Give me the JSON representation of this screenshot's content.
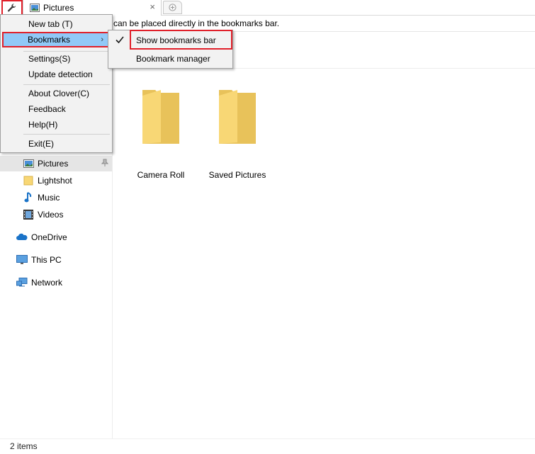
{
  "tabbar": {
    "menu_icon": "wrench-icon",
    "tab": {
      "title": "Pictures",
      "icon": "pictures-folder-icon",
      "close_label": "×"
    },
    "new_tab_icon": "plus-circle-icon"
  },
  "hint_bar": {
    "text": "can be placed directly in the bookmarks bar."
  },
  "nav": {
    "items": [
      {
        "label": "Pictures",
        "icon": "pictures-folder-icon",
        "selected": true,
        "pinned": true
      },
      {
        "label": "Lightshot",
        "icon": "folder-icon"
      },
      {
        "label": "Music",
        "icon": "music-icon"
      },
      {
        "label": "Videos",
        "icon": "videos-icon"
      },
      {
        "label": "OneDrive",
        "icon": "cloud-icon"
      },
      {
        "label": "This PC",
        "icon": "computer-icon"
      },
      {
        "label": "Network",
        "icon": "network-icon"
      }
    ]
  },
  "content": {
    "folders": [
      {
        "label": "Camera Roll",
        "icon": "folder-icon"
      },
      {
        "label": "Saved Pictures",
        "icon": "folder-icon"
      }
    ]
  },
  "status": {
    "items_count": "2 items"
  },
  "menu": {
    "items": [
      {
        "label": "New tab (T)"
      },
      {
        "label": "Bookmarks",
        "has_submenu": true,
        "active": true
      },
      {
        "label": "Settings(S)"
      },
      {
        "label": "Update detection"
      },
      {
        "label": "About Clover(C)"
      },
      {
        "label": "Feedback"
      },
      {
        "label": "Help(H)"
      },
      {
        "label": "Exit(E)"
      }
    ],
    "submenu_arrow": "›"
  },
  "submenu": {
    "items": [
      {
        "label": "Show bookmarks bar",
        "checked": true
      },
      {
        "label": "Bookmark manager",
        "checked": false
      }
    ]
  },
  "colors": {
    "highlight_border": "#e0202a",
    "menu_active_bg": "#91c9f7",
    "folder_yellow": "#f8d775"
  }
}
